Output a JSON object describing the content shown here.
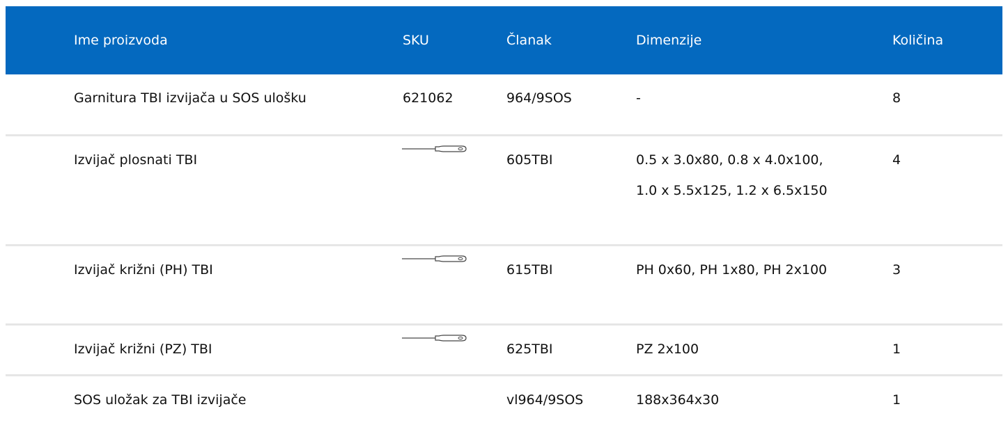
{
  "table": {
    "columns": [
      "Ime proizvoda",
      "SKU",
      "Članak",
      "Dimenzije",
      "Količina"
    ],
    "rows": [
      {
        "name": "Garnitura TBI izvijača u SOS ulošku",
        "sku": "621062",
        "sku_icon": "",
        "article": "964/9SOS",
        "dimensions": "-",
        "qty": "8"
      },
      {
        "name": "Izvijač plosnati TBI",
        "sku": "",
        "sku_icon": "flat-screwdriver-icon",
        "article": "605TBI",
        "dimensions": "0.5 x 3.0x80, 0.8 x 4.0x100, 1.0 x 5.5x125, 1.2 x 6.5x150",
        "qty": "4"
      },
      {
        "name": "Izvijač križni (PH) TBI",
        "sku": "",
        "sku_icon": "phillips-screwdriver-icon",
        "article": "615TBI",
        "dimensions": "PH 0x60, PH 1x80, PH 2x100",
        "qty": "3"
      },
      {
        "name": "Izvijač križni (PZ) TBI",
        "sku": "",
        "sku_icon": "pozidriv-screwdriver-icon",
        "article": "625TBI",
        "dimensions": "PZ 2x100",
        "qty": "1"
      },
      {
        "name": "SOS uložak za TBI izvijače",
        "sku": "",
        "sku_icon": "",
        "article": "vl964/9SOS",
        "dimensions": "188x364x30",
        "qty": "1"
      }
    ]
  },
  "colors": {
    "header_bg": "#0469BF",
    "header_text": "#FFFFFF",
    "row_divider": "#E6E6E6"
  }
}
